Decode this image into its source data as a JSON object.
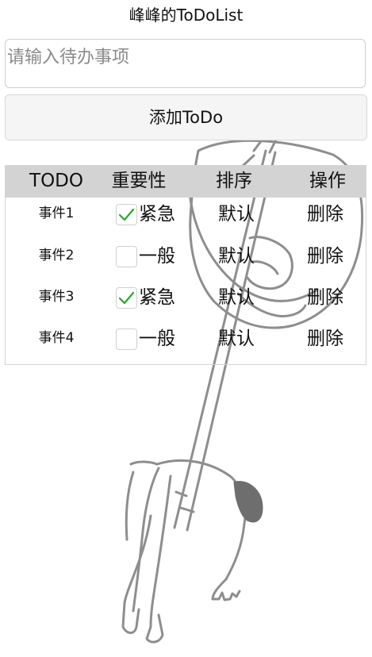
{
  "app": {
    "title": "峰峰的ToDoList"
  },
  "input": {
    "placeholder": "请输入待办事项",
    "value": ""
  },
  "add_button": {
    "label": "添加ToDo"
  },
  "table": {
    "headers": [
      "TODO",
      "重要性",
      "排序",
      "操作"
    ],
    "rows": [
      {
        "name": "事件1",
        "checked": true,
        "importance": "紧急",
        "sort": "默认",
        "action": "删除"
      },
      {
        "name": "事件2",
        "checked": false,
        "importance": "一般",
        "sort": "默认",
        "action": "删除"
      },
      {
        "name": "事件3",
        "checked": true,
        "importance": "紧急",
        "sort": "默认",
        "action": "删除"
      },
      {
        "name": "事件4",
        "checked": false,
        "importance": "一般",
        "sort": "默认",
        "action": "删除"
      }
    ]
  },
  "colors": {
    "check": "#2da52d",
    "header_bg": "#d3d3d3"
  },
  "icons": {
    "check": "check-icon",
    "background": "hanging-figure-illustration"
  }
}
